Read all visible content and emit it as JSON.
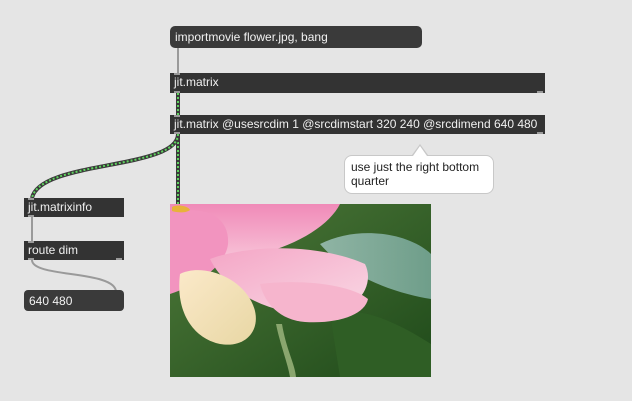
{
  "objects": {
    "message": "importmovie flower.jpg, bang",
    "jit_matrix_1": "jit.matrix",
    "jit_matrix_2": "jit.matrix @usesrcdim 1 @srcdimstart 320 240 @srcdimend 640 480",
    "matrixinfo": "jit.matrixinfo",
    "route": "route dim",
    "number_box": "640 480"
  },
  "comment": "use just the right bottom quarter",
  "colors": {
    "canvas": "#e5e5e5",
    "object_box": "#333333",
    "patch_cord": "#9a9a9a",
    "matrix_cord_dash": "#4caf50"
  },
  "display": {
    "content": "pink lotus flower petals over green leaves"
  }
}
